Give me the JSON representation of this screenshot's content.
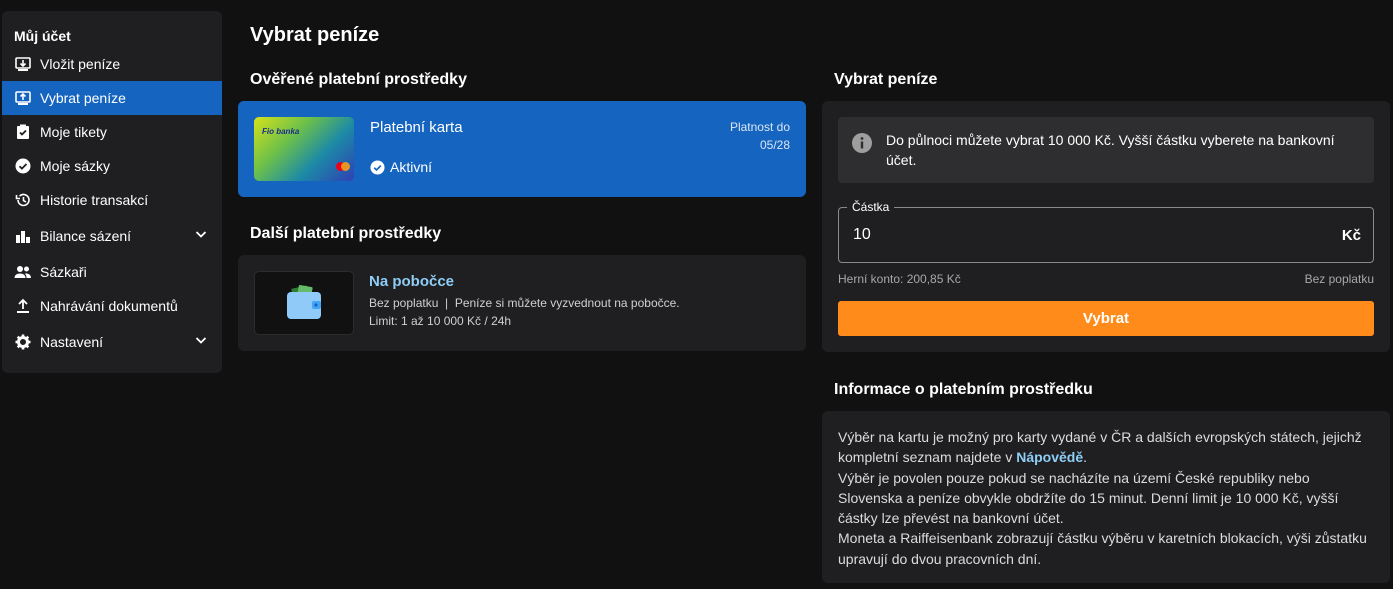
{
  "sidebar": {
    "title": "Můj účet",
    "items": [
      {
        "label": "Vložit peníze",
        "icon": "deposit-icon"
      },
      {
        "label": "Vybrat peníze",
        "icon": "withdraw-icon"
      },
      {
        "label": "Moje tikety",
        "icon": "ticket-icon"
      },
      {
        "label": "Moje sázky",
        "icon": "check-circle-icon"
      },
      {
        "label": "Historie transakcí",
        "icon": "history-icon"
      },
      {
        "label": "Bilance sázení",
        "icon": "bar-chart-icon"
      },
      {
        "label": "Sázkaři",
        "icon": "people-icon"
      },
      {
        "label": "Nahrávání dokumentů",
        "icon": "upload-icon"
      },
      {
        "label": "Nastavení",
        "icon": "gear-icon"
      }
    ],
    "active_item": "Vybrat peníze"
  },
  "page": {
    "title": "Vybrat peníze"
  },
  "verified": {
    "heading": "Ověřené platební prostředky",
    "card_name": "Platební karta",
    "card_bank_logo": "Fio banka",
    "status": "Aktivní",
    "validity_label": "Platnost do",
    "validity_value": "05/28"
  },
  "other": {
    "heading": "Další platební prostředky",
    "name": "Na pobočce",
    "description": "Bez poplatku  |  Peníze si můžete vyzvednout na pobočce.",
    "limit": "Limit: 1 až 10 000 Kč / 24h"
  },
  "withdraw": {
    "heading": "Vybrat peníze",
    "info": "Do půlnoci můžete vybrat 10 000 Kč. Vyšší částku vyberete na bankovní účet.",
    "amount_label": "Částka",
    "amount_value": "10",
    "currency": "Kč",
    "balance": "Herní konto: 200,85 Kč",
    "fee": "Bez poplatku",
    "submit_label": "Vybrat"
  },
  "payment_info": {
    "heading": "Informace o platebním prostředku",
    "p1_before": "Výběr na kartu je možný pro karty vydané v ČR a dalších evropských státech, jejichž kompletní seznam najdete v ",
    "p1_link": "Nápovědě",
    "p1_after": ".",
    "p2": "Výběr je povolen pouze pokud se nacházíte na území České republiky nebo Slovenska a peníze obvykle obdržíte do 15 minut. Denní limit je 10 000 Kč, vyšší částky lze převést na bankovní účet.",
    "p3": "Moneta a Raiffeisenbank zobrazují částku výběru v karetních blokacích, výši zůstatku upravují do dvou pracovních dní."
  },
  "colors": {
    "background": "#111112",
    "panel": "#1f1f21",
    "accent_blue": "#1565c0",
    "accent_orange": "#ff8c1a",
    "link": "#8ecdf5"
  }
}
